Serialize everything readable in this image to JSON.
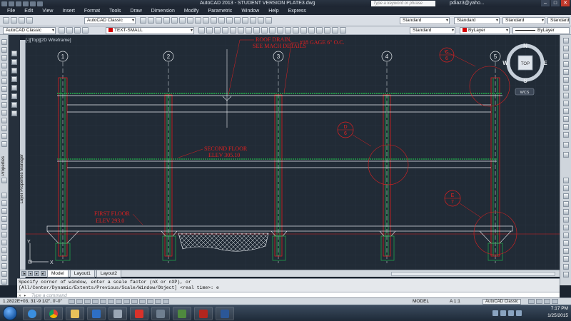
{
  "titlebar": {
    "title": "AutoCAD 2013 - STUDENT VERSION    PLATE3.dwg",
    "search_placeholder": "Type a keyword or phrase",
    "user": "pdiaz3@yaho...",
    "min": "–",
    "max": "□",
    "close": "✕"
  },
  "menubar": {
    "items": [
      "File",
      "Edit",
      "View",
      "Insert",
      "Format",
      "Tools",
      "Draw",
      "Dimension",
      "Modify",
      "Parametric",
      "Window",
      "Help",
      "Express"
    ]
  },
  "toolbar1": {
    "workspace": "AutoCAD Classic",
    "text_style": "Standard",
    "dim_style": "Standard",
    "table_style": "Standard",
    "mleader_style": "Standard"
  },
  "toolbar2": {
    "workspace": "AutoCAD Classic",
    "layer": "TEXT-SMALL",
    "plot_style": "Standard",
    "color": "ByLayer",
    "linetype": "ByLayer"
  },
  "viewport": {
    "label": "[-][Top][2D Wireframe]"
  },
  "drawing": {
    "grid_bubbles": [
      "1",
      "2",
      "3",
      "4",
      "5"
    ],
    "annotations": {
      "roof_drain_1": "ROOF DRAIN,",
      "roof_drain_2": "SEE MACH DETAILS",
      "gage": "#18 GAGE 6\" O.C.",
      "second_floor_1": "SECOND FLOOR",
      "second_floor_2": "ELEV 305.10",
      "first_floor_1": "FIRST FLOOR",
      "first_floor_2": "ELEV 293.0"
    },
    "details": [
      {
        "top": "C",
        "bottom": "6"
      },
      {
        "top": "D",
        "bottom": "6"
      },
      {
        "top": "E",
        "bottom": "7"
      }
    ],
    "ucs_x": "X",
    "ucs_y": "Y"
  },
  "navcube": {
    "n": "N",
    "s": "S",
    "e": "E",
    "w": "W",
    "face": "TOP",
    "wcs": "WCS"
  },
  "side_labels": {
    "layer_manager": "Layer Properties Manager",
    "properties": "Properties"
  },
  "tabs": [
    "Model",
    "Layout1",
    "Layout2"
  ],
  "command": {
    "line1": "Specify corner of window, enter a scale factor (nX or nXP), or",
    "line2": "[All/Center/Dynamic/Extents/Previous/Scale/Window/Object] <real time>: e",
    "placeholder": "Type a command"
  },
  "statusbar": {
    "coords": "1.2822E+03,  31'-9 1/2\", 0'-0\"",
    "model": "MODEL",
    "scale": "A 1:1",
    "workspace": "AutoCAD Classic"
  },
  "taskbar": {
    "time": "7:17 PM",
    "date": "1/25/2015"
  },
  "colors": {
    "red": "#e02020",
    "green": "#22b14c",
    "white": "#e8ecf0",
    "grid": "#2c3745",
    "bg": "#212b36"
  }
}
